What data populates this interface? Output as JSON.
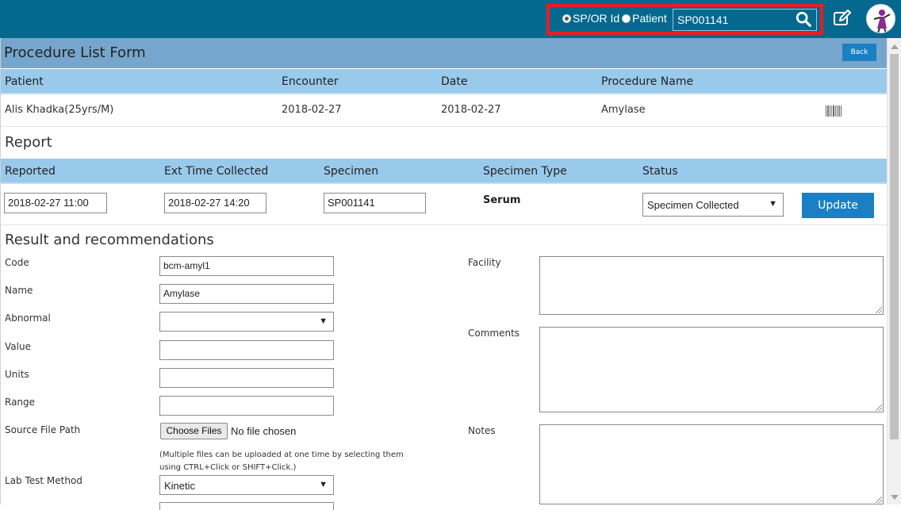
{
  "topbar": {
    "radio_sp_or_id": "SP/OR Id",
    "radio_patient": "Patient",
    "search_value": "SP001141"
  },
  "form": {
    "title": "Procedure List Form",
    "back_label": "Back"
  },
  "procedure_table": {
    "headers": [
      "Patient",
      "Encounter",
      "Date",
      "Procedure Name"
    ],
    "row": [
      "Alis Khadka(25yrs/M)",
      "2018-02-27",
      "2018-02-27",
      "Amylase"
    ]
  },
  "report": {
    "title": "Report",
    "headers": [
      "Reported",
      "Ext Time Collected",
      "Specimen",
      "Specimen Type",
      "Status"
    ],
    "reported": "2018-02-27 11:00",
    "ext_time_collected": "2018-02-27 14:20",
    "specimen": "SP001141",
    "specimen_type": "Serum",
    "status": "Specimen Collected",
    "update_label": "Update"
  },
  "results": {
    "title": "Result and recommendations",
    "code_label": "Code",
    "code_value": "bcm-amyl1",
    "name_label": "Name",
    "name_value": "Amylase",
    "abnormal_label": "Abnormal",
    "abnormal_value": "",
    "value_label": "Value",
    "units_label": "Units",
    "range_label": "Range",
    "source_file_label": "Source File Path",
    "choose_files_label": "Choose Files",
    "no_file_text": "No file chosen",
    "help_text": "(Multiple files can be uploaded at one time by selecting them using CTRL+Click or SHIFT+Click.)",
    "lab_test_method_label": "Lab Test Method",
    "lab_test_method_value": "Kinetic",
    "facility_label": "Facility",
    "comments_label": "Comments",
    "notes_label": "Notes"
  },
  "colors": {
    "topbar": "#05698f",
    "header_bar": "#76a6cd",
    "table_header": "#99caec",
    "button": "#1b7fc4",
    "highlight_border": "#ea1b25"
  }
}
